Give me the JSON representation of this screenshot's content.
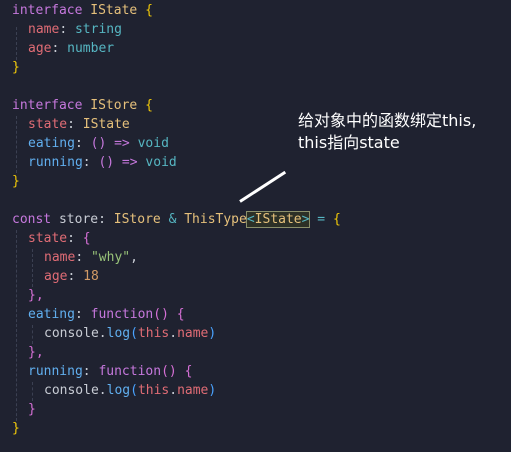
{
  "annotation": {
    "line1": "给对象中的函数绑定this,",
    "line2": "this指向state"
  },
  "code": {
    "l1": {
      "kw": "interface",
      "name": "IState",
      "brace": "{"
    },
    "l2": {
      "prop": "name",
      "colon": ":",
      "type": "string"
    },
    "l3": {
      "prop": "age",
      "colon": ":",
      "type": "number"
    },
    "l4": {
      "brace": "}"
    },
    "l6": {
      "kw": "interface",
      "name": "IStore",
      "brace": "{"
    },
    "l7": {
      "prop": "state",
      "colon": ":",
      "type": "IState"
    },
    "l8": {
      "prop": "eating",
      "colon": ":",
      "sig": "() =>",
      "type": "void"
    },
    "l9": {
      "prop": "running",
      "colon": ":",
      "sig": "() =>",
      "type": "void"
    },
    "l10": {
      "brace": "}"
    },
    "l12": {
      "kw": "const",
      "var": "store",
      "colon": ":",
      "t1": "IStore",
      "amp": "&",
      "t2": "ThisType",
      "lt": "<",
      "t3": "IState",
      "gt": ">",
      "eq": "=",
      "brace": "{"
    },
    "l13": {
      "prop": "state",
      "colon": ":",
      "brace": "{"
    },
    "l14": {
      "prop": "name",
      "colon": ":",
      "val": "\"why\"",
      "comma": ","
    },
    "l15": {
      "prop": "age",
      "colon": ":",
      "val": "18"
    },
    "l16": {
      "brace": "},"
    },
    "l17": {
      "prop": "eating",
      "colon": ":",
      "kw": "function",
      "paren": "()",
      "brace": "{"
    },
    "l18": {
      "obj": "console",
      "dot": ".",
      "fn": "log",
      "open": "(",
      "th": "this",
      "dot2": ".",
      "prop": "name",
      "close": ")"
    },
    "l19": {
      "brace": "},"
    },
    "l20": {
      "prop": "running",
      "colon": ":",
      "kw": "function",
      "paren": "()",
      "brace": "{"
    },
    "l21": {
      "obj": "console",
      "dot": ".",
      "fn": "log",
      "open": "(",
      "th": "this",
      "dot2": ".",
      "prop": "name",
      "close": ")"
    },
    "l22": {
      "brace": "}"
    },
    "l23": {
      "brace": "}"
    }
  }
}
